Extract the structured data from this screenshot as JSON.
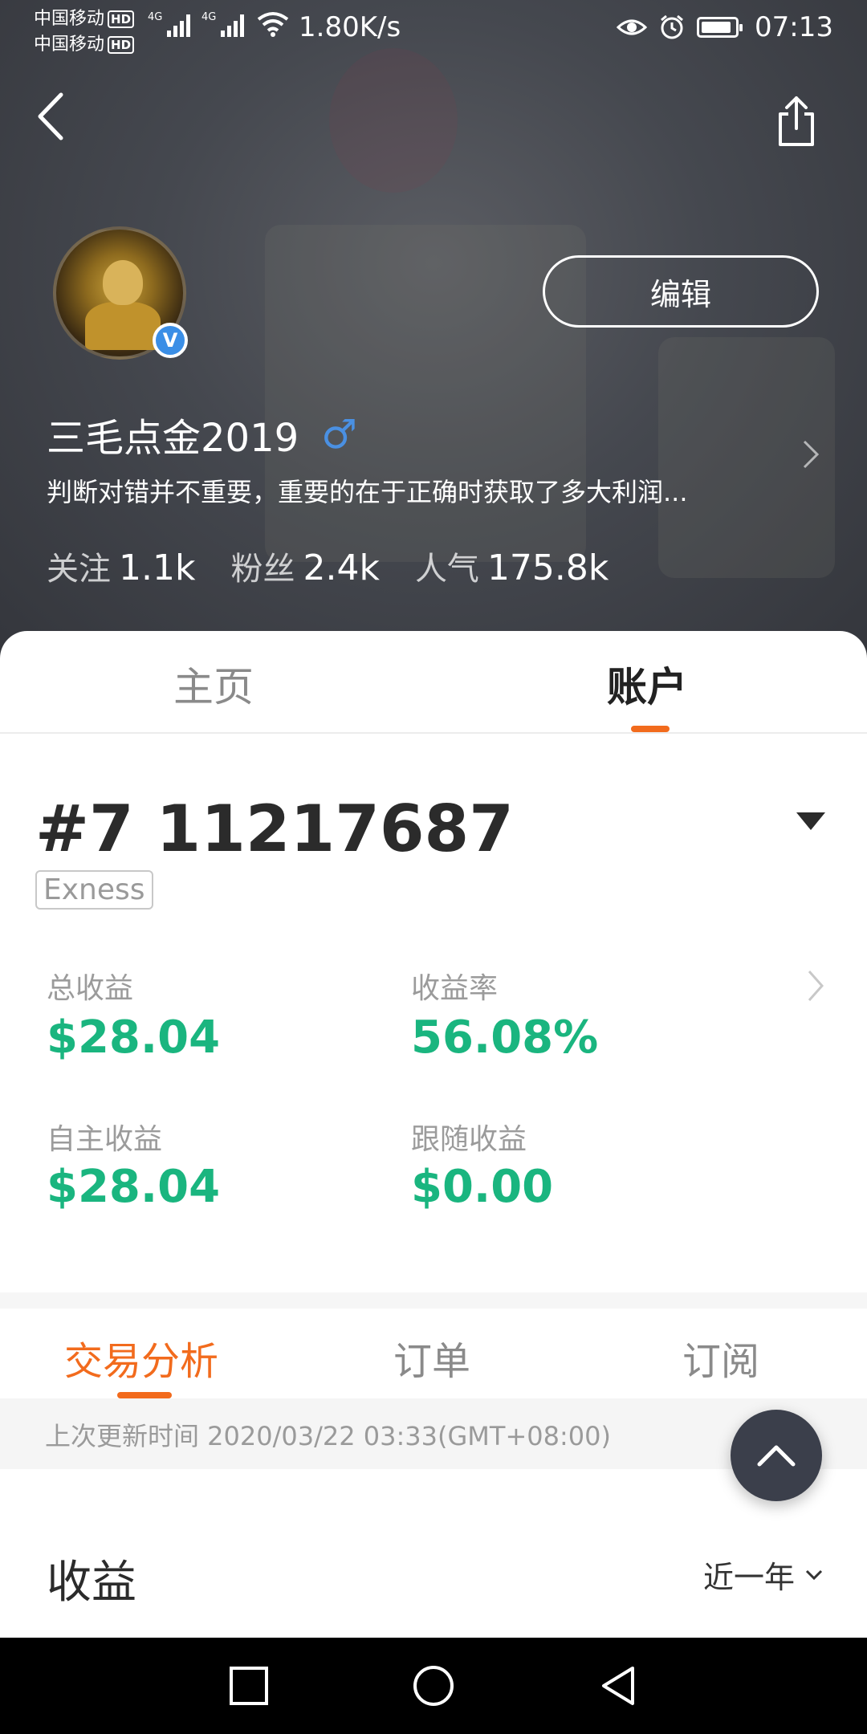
{
  "status_bar": {
    "carrier1": "中国移动",
    "carrier2": "中国移动",
    "hd_badge": "HD",
    "network_label": "4G",
    "speed": "1.80K/s",
    "time": "07:13"
  },
  "profile": {
    "edit_label": "编辑",
    "username": "三毛点金2019",
    "gender_symbol": "♂",
    "verified_badge": "V",
    "bio": "判断对错并不重要，重要的在于正确时获取了多大利润...",
    "stats": [
      {
        "label": "关注",
        "value": "1.1k"
      },
      {
        "label": "粉丝",
        "value": "2.4k"
      },
      {
        "label": "人气",
        "value": "175.8k"
      }
    ]
  },
  "main_tabs": [
    {
      "label": "主页",
      "active": false
    },
    {
      "label": "账户",
      "active": true
    }
  ],
  "account": {
    "number": "#7 11217687",
    "broker": "Exness",
    "metrics": [
      {
        "label": "总收益",
        "value": "$28.04"
      },
      {
        "label": "收益率",
        "value": "56.08%"
      },
      {
        "label": "自主收益",
        "value": "$28.04"
      },
      {
        "label": "跟随收益",
        "value": "$0.00"
      }
    ]
  },
  "sub_tabs": [
    {
      "label": "交易分析",
      "active": true
    },
    {
      "label": "订单",
      "active": false
    },
    {
      "label": "订阅",
      "active": false
    }
  ],
  "last_update": "上次更新时间 2020/03/22 03:33(GMT+08:00)",
  "earnings": {
    "title": "收益",
    "period": "近一年"
  },
  "colors": {
    "accent": "#f26b1d",
    "positive": "#1ab57f",
    "header_bg": "#45484f",
    "verified": "#3a8ee6",
    "gender": "#4a90e2"
  },
  "icons": [
    "back-arrow-icon",
    "share-icon",
    "verified-icon",
    "chevron-right-icon",
    "triangle-down-icon",
    "chevron-up-icon",
    "chevron-down-icon",
    "recent-apps-icon",
    "home-circle-icon",
    "back-triangle-icon"
  ]
}
